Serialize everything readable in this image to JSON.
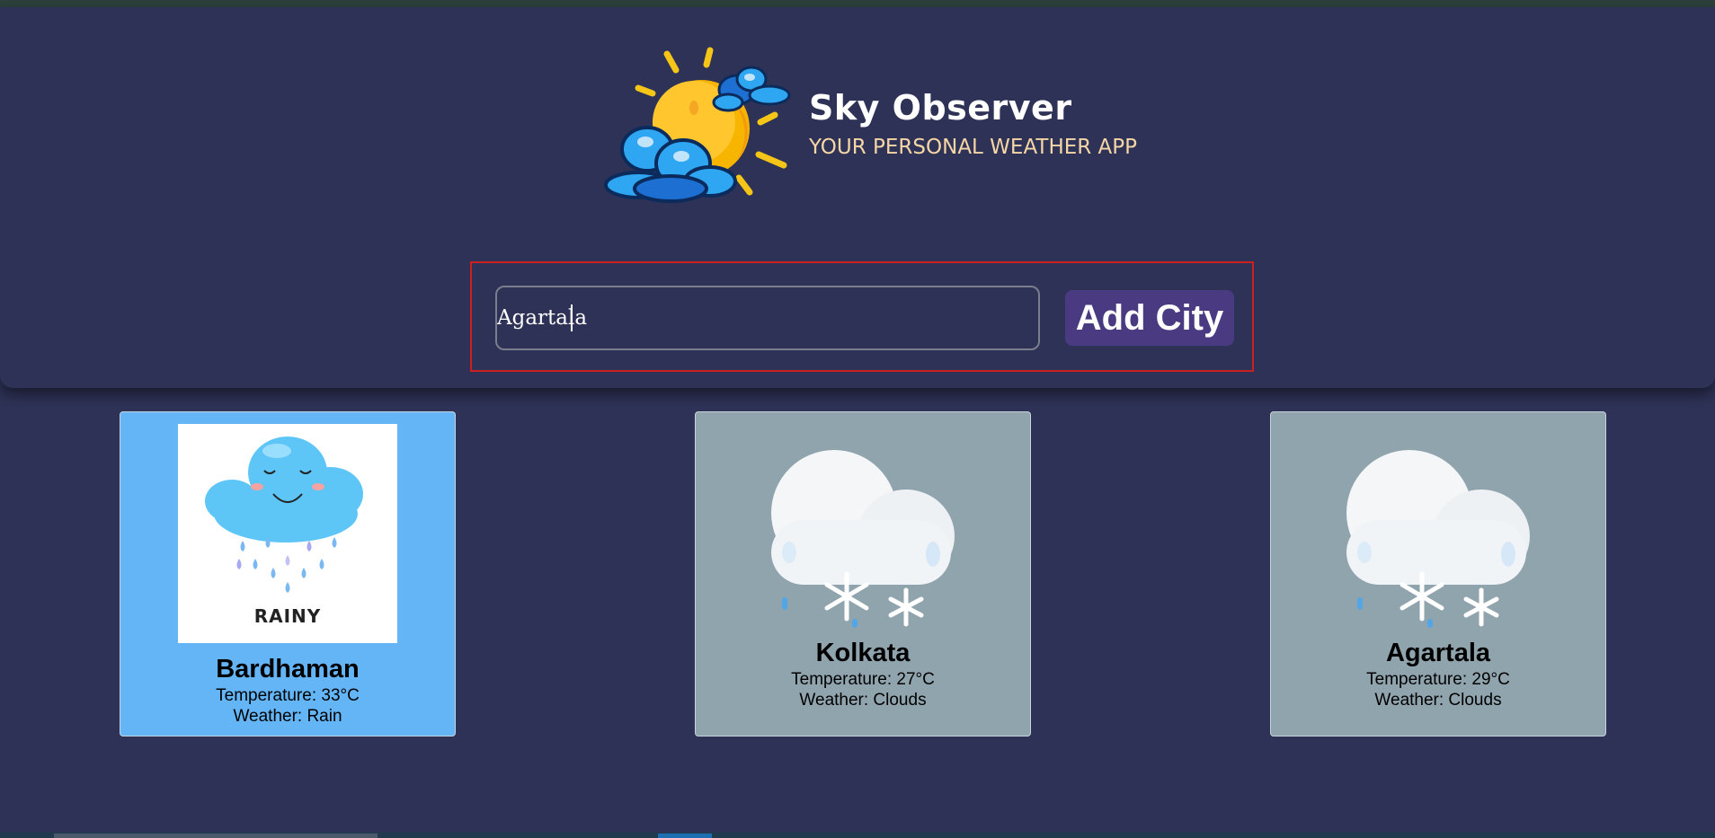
{
  "app": {
    "title": "Sky Observer",
    "subtitle": "YOUR PERSONAL WEATHER APP"
  },
  "search": {
    "value": "Agartala",
    "button_label": "Add City"
  },
  "cards": [
    {
      "city": "Bardhaman",
      "temperature": "Temperature: 33°C",
      "weather": "Weather: Rain",
      "image_label": "RAINY",
      "icon": "rainy-cloud-icon",
      "background": "#64b5f6"
    },
    {
      "city": "Kolkata",
      "temperature": "Temperature: 27°C",
      "weather": "Weather: Clouds",
      "icon": "snow-cloud-icon",
      "background": "#90a4ae"
    },
    {
      "city": "Agartala",
      "temperature": "Temperature: 29°C",
      "weather": "Weather: Clouds",
      "icon": "snow-cloud-icon",
      "background": "#90a4ae"
    }
  ],
  "colors": {
    "page_bg": "#2e3256",
    "accent_button": "#4a3a82",
    "subtitle": "#f5d6a6",
    "highlight_border": "#cc1f1f"
  }
}
